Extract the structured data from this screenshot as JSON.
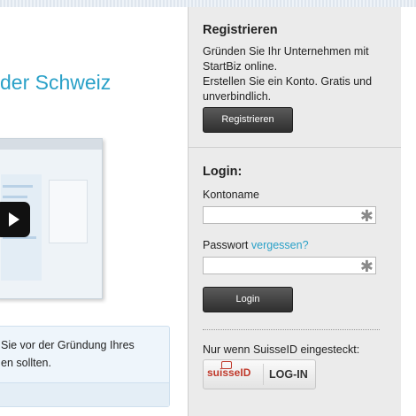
{
  "hero": {
    "title": "der Schweiz"
  },
  "video": {
    "play_icon": "play-icon"
  },
  "info": {
    "line1": "Sie vor der Gründung Ihres",
    "line2": "en sollten."
  },
  "register": {
    "heading": "Registrieren",
    "text1": "Gründen Sie Ihr Unternehmen mit StartBiz online.",
    "text2": "Erstellen Sie ein Konto. Gratis und unverbindlich.",
    "button": "Registrieren"
  },
  "login": {
    "heading": "Login:",
    "account_label": "Kontoname",
    "password_label": "Passwort",
    "forgot_link": "vergessen?",
    "required_mark": "✱",
    "button": "Login",
    "suisseid_note": "Nur wenn SuisseID eingesteckt:",
    "suisseid_logo": "suisseID",
    "suisseid_login": "LOG-IN"
  },
  "colors": {
    "accent": "#2aa1c8",
    "button_dark": "#3a3a3a",
    "panel_bg": "#ebebeb"
  }
}
